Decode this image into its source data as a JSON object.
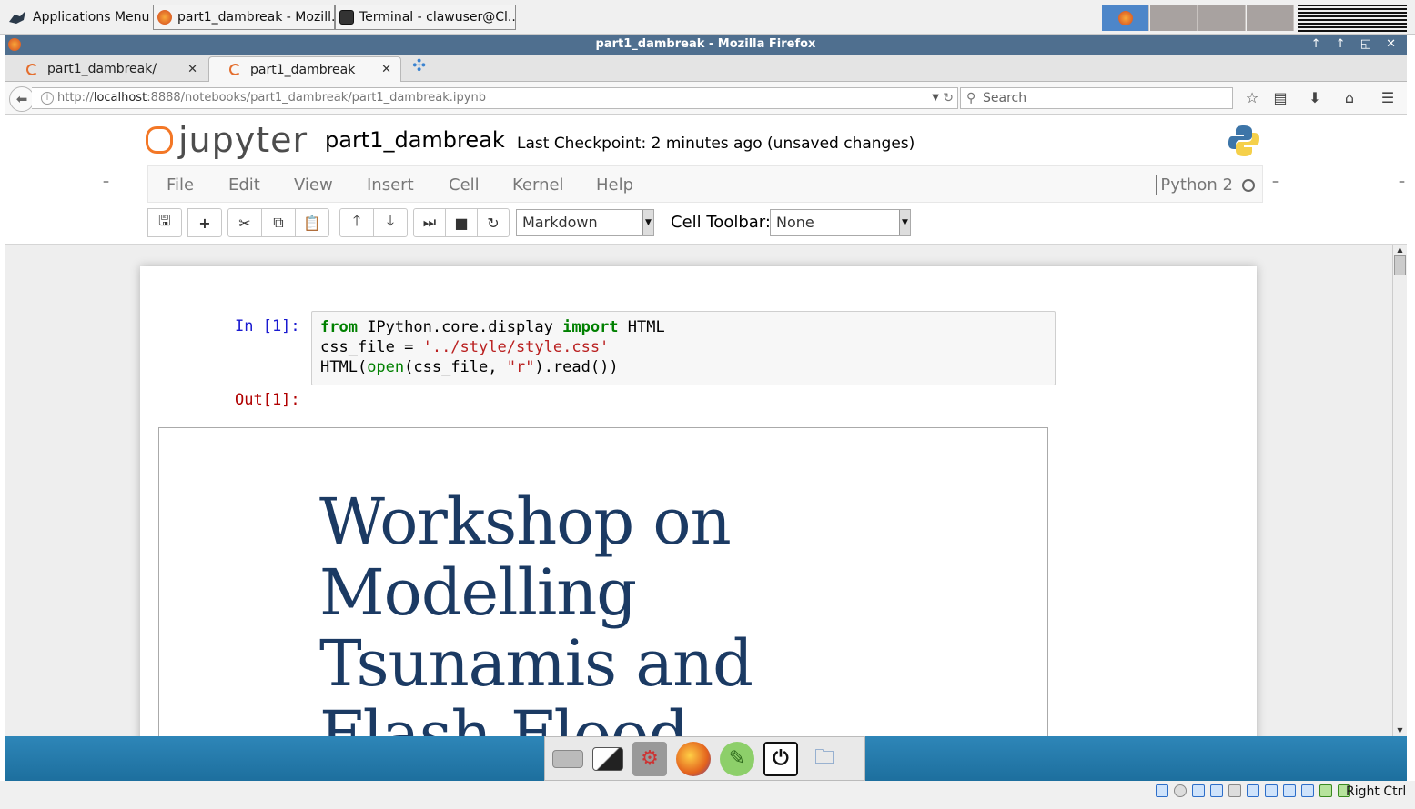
{
  "os_panel": {
    "apps_menu": "Applications Menu",
    "tasks": [
      "part1_dambreak - Mozill...",
      "Terminal - clawuser@Cl..."
    ]
  },
  "window": {
    "title": "part1_dambreak - Mozilla Firefox",
    "controls": "↑ ↑ ◱ ✕"
  },
  "tabs": [
    {
      "label": "part1_dambreak/"
    },
    {
      "label": "part1_dambreak"
    }
  ],
  "nav": {
    "url_prefix": "http://",
    "url_host": "localhost",
    "url_rest": ":8888/notebooks/part1_dambreak/part1_dambreak.ipynb",
    "search_placeholder": "Search"
  },
  "jupyter": {
    "logo_text": "jupyter",
    "notebook_name": "part1_dambreak",
    "checkpoint": "Last Checkpoint: 2 minutes ago (unsaved changes)",
    "menu": [
      "File",
      "Edit",
      "View",
      "Insert",
      "Cell",
      "Kernel",
      "Help"
    ],
    "kernel": "Python 2",
    "cell_type": "Markdown",
    "cell_toolbar_label": "Cell Toolbar:",
    "cell_toolbar_value": "None"
  },
  "cell": {
    "in_prompt": "In [1]:",
    "out_prompt": "Out[1]:",
    "code": {
      "line1_kw1": "from",
      "line1_mid": " IPython.core.display ",
      "line1_kw2": "import",
      "line1_end": " HTML",
      "line2_start": "css_file = ",
      "line2_str": "'../style/style.css'",
      "line3_start": "HTML(",
      "line3_bi": "open",
      "line3_mid": "(css_file, ",
      "line3_str": "\"r\"",
      "line3_end": ").read())"
    },
    "output_title": "Workshop on Modelling Tsunamis and Flash Flood"
  },
  "status_bar": {
    "host_key": "Right Ctrl"
  },
  "colors": {
    "title_bar": "#4f6f8f",
    "jupyter_orange": "#f37726",
    "output_title": "#1b3a63",
    "dock_blue": "#2e86b8"
  }
}
